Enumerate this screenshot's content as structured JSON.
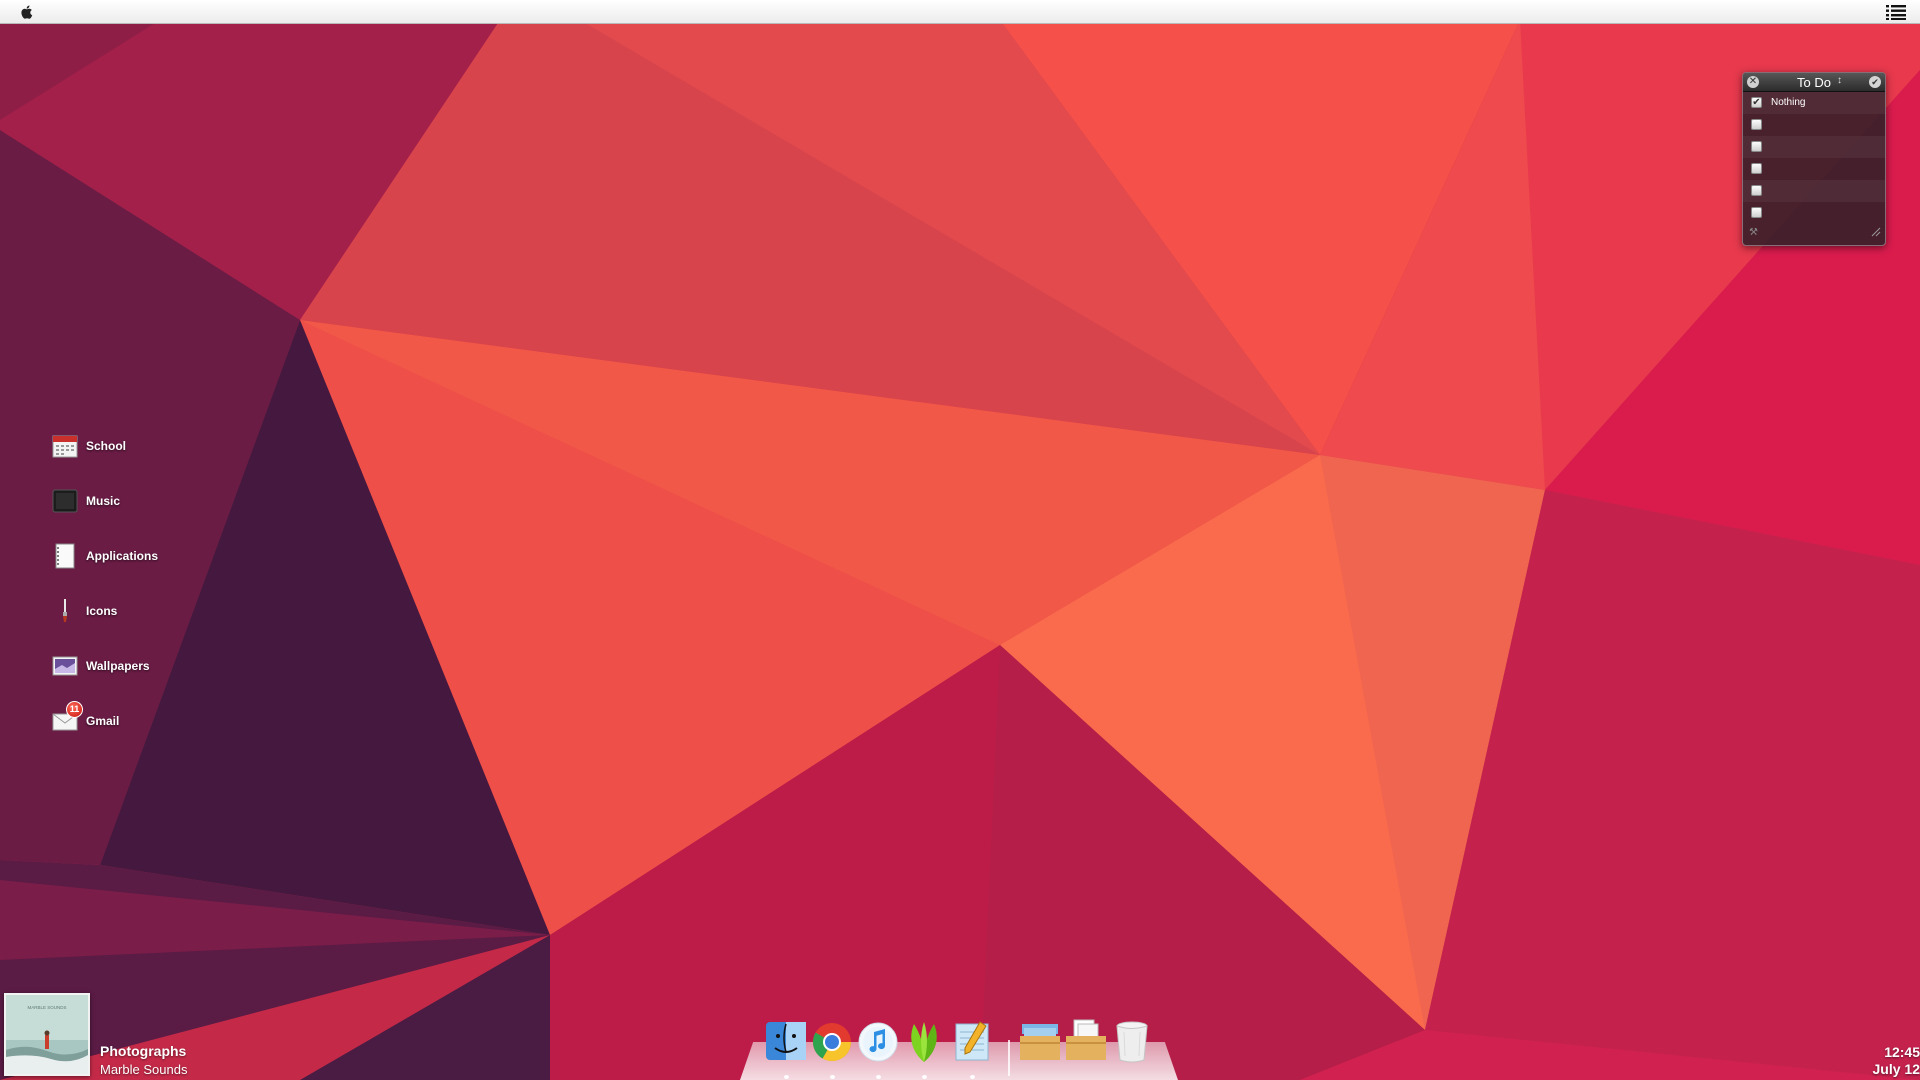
{
  "menubar": {
    "left_icon": "apple-logo-icon",
    "right_icon": "list-menu-icon"
  },
  "shortcuts": [
    {
      "label": "School",
      "icon": "calendar-icon"
    },
    {
      "label": "Music",
      "icon": "music-folder-icon"
    },
    {
      "label": "Applications",
      "icon": "notebook-icon"
    },
    {
      "label": "Icons",
      "icon": "brush-icon"
    },
    {
      "label": "Wallpapers",
      "icon": "picture-icon"
    },
    {
      "label": "Gmail",
      "icon": "mail-icon",
      "badge": "11"
    }
  ],
  "todo": {
    "title": "To Do",
    "items": [
      {
        "text": "Nothing",
        "checked": true
      },
      {
        "text": "",
        "checked": false
      },
      {
        "text": "",
        "checked": false
      },
      {
        "text": "",
        "checked": false
      },
      {
        "text": "",
        "checked": false
      },
      {
        "text": "",
        "checked": false
      }
    ]
  },
  "now_playing": {
    "title": "Photographs",
    "artist": "Marble Sounds",
    "art_text": "MARBLE SOUNDS"
  },
  "clock": {
    "time": "12:45",
    "date": "July 12"
  },
  "dock": {
    "apps": [
      "finder-icon",
      "chrome-icon",
      "itunes-icon",
      "leaf-app-icon",
      "textedit-icon",
      "downloads-folder-icon",
      "documents-folder-icon",
      "trash-icon"
    ]
  },
  "colors": {
    "wallpaper_base": "#c9304a",
    "accent_orange": "#f45a48",
    "deep_purple": "#4a1b43"
  }
}
